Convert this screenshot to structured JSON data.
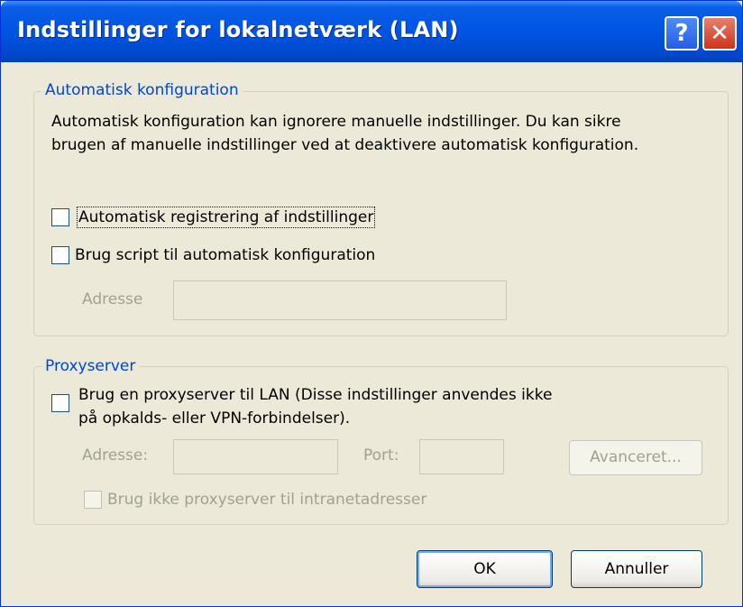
{
  "window": {
    "title": "Indstillinger for lokalnetværk (LAN)"
  },
  "titlebar": {
    "help_label": "?",
    "close_label": "✕"
  },
  "auto_config": {
    "legend": "Automatisk konfiguration",
    "description_line1": "Automatisk konfiguration kan ignorere manuelle indstillinger. Du kan sikre",
    "description_line2": "brugen af manuelle indstillinger ved at deaktivere automatisk konfiguration.",
    "auto_detect_label": "Automatisk registrering af indstillinger",
    "auto_detect_checked": false,
    "script_label": "Brug script til automatisk konfiguration",
    "script_checked": false,
    "address_label": "Adresse",
    "address_value": ""
  },
  "proxy": {
    "legend": "Proxyserver",
    "use_proxy_line1": "Brug en proxyserver til LAN (Disse indstillinger anvendes ikke",
    "use_proxy_line2": "på opkalds- eller VPN-forbindelser).",
    "use_proxy_checked": false,
    "address_label": "Adresse:",
    "address_value": "",
    "port_label": "Port:",
    "port_value": "",
    "advanced_label": "Avanceret...",
    "bypass_label": "Brug ikke proxyserver til intranetadresser",
    "bypass_checked": false
  },
  "buttons": {
    "ok_label": "OK",
    "cancel_label": "Annuller"
  },
  "colors": {
    "titlebar": "#0054e3",
    "dialog_bg": "#ece9d8",
    "legend_text": "#0046d5",
    "disabled_text": "#a1a192"
  }
}
